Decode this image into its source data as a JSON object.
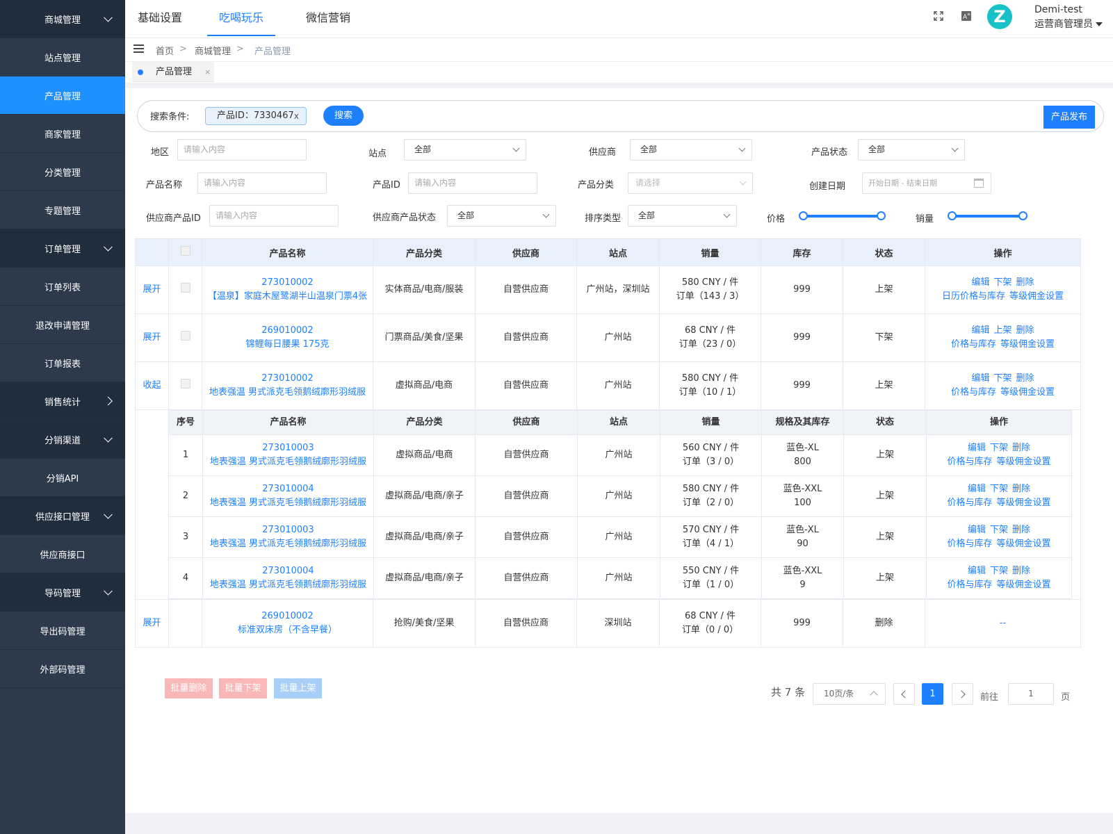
{
  "sidebar": {
    "items": [
      {
        "label": "商城管理",
        "type": "group",
        "chev": "down"
      },
      {
        "label": "站点管理",
        "type": "item"
      },
      {
        "label": "产品管理",
        "type": "active"
      },
      {
        "label": "商家管理",
        "type": "item"
      },
      {
        "label": "分类管理",
        "type": "item"
      },
      {
        "label": "专题管理",
        "type": "item"
      },
      {
        "label": "订单管理",
        "type": "group",
        "chev": "down"
      },
      {
        "label": "订单列表",
        "type": "item"
      },
      {
        "label": "退改申请管理",
        "type": "item"
      },
      {
        "label": "订单报表",
        "type": "item"
      },
      {
        "label": "销售统计",
        "type": "group",
        "chev": "right"
      },
      {
        "label": "分销渠道",
        "type": "group",
        "chev": "down"
      },
      {
        "label": "分销API",
        "type": "item"
      },
      {
        "label": "供应接口管理",
        "type": "group",
        "chev": "down"
      },
      {
        "label": "供应商接口",
        "type": "item"
      },
      {
        "label": "导码管理",
        "type": "group",
        "chev": "down"
      },
      {
        "label": "导出码管理",
        "type": "item"
      },
      {
        "label": "外部码管理",
        "type": "item"
      }
    ]
  },
  "header": {
    "tabs": [
      "基础设置",
      "吃喝玩乐",
      "微信营销"
    ],
    "active_tab": 1,
    "avatar_letter": "Z",
    "user_name": "Demi-test",
    "user_role": "运营商管理员"
  },
  "breadcrumb": [
    "首页",
    "商城管理",
    "产品管理"
  ],
  "page_tag": "产品管理",
  "search": {
    "label": "搜索条件:",
    "chip": "产品ID：7330467",
    "chip_close": "x",
    "search_btn": "搜索",
    "publish_btn": "产品发布"
  },
  "filters": {
    "region_label": "地区",
    "region_ph": "请输入内容",
    "site_label": "站点",
    "site_val": "全部",
    "supplier_label": "供应商",
    "supplier_val": "全部",
    "status_label": "产品状态",
    "status_val": "全部",
    "name_label": "产品名称",
    "name_ph": "请输入内容",
    "id_label": "产品ID",
    "id_ph": "请输入内容",
    "cat_label": "产品分类",
    "cat_ph": "请选择",
    "date_label": "创建日期",
    "date_ph": "开始日期  -  结束日期",
    "sup_pid_label": "供应商产品ID",
    "sup_pid_ph": "请输入内容",
    "sup_status_label": "供应商产品状态",
    "sup_status_val": "全部",
    "sort_label": "排序类型",
    "sort_val": "全部",
    "price_label": "价格",
    "sales_label": "销量"
  },
  "table": {
    "headers": [
      "产品名称",
      "产品分类",
      "供应商",
      "站点",
      "销量",
      "库存",
      "状态",
      "操作"
    ],
    "rows": [
      {
        "toggle": "展开",
        "id": "273010002",
        "name": "【温泉】家庭木屋鹭湖半山温泉门票4张",
        "cat": "实体商品/电商/服装",
        "sup": "自营供应商",
        "site": "广州站，深圳站",
        "price": "580 CNY / 件",
        "orders": "订单（143 / 3）",
        "stock": "999",
        "status": "上架",
        "ops1": [
          "编辑",
          "下架",
          "删除"
        ],
        "ops2": [
          "日历价格与库存",
          "等级佣金设置"
        ]
      },
      {
        "toggle": "展开",
        "id": "269010002",
        "name": "锦鲤每日腰果 175克",
        "cat": "门票商品/美食/坚果",
        "sup": "自营供应商",
        "site": "广州站",
        "price": "68 CNY / 件",
        "orders": "订单（23 / 0）",
        "stock": "999",
        "status": "下架",
        "ops1": [
          "编辑",
          "上架",
          "删除"
        ],
        "ops2": [
          "价格与库存",
          "等级佣金设置"
        ]
      },
      {
        "toggle": "收起",
        "id": "273010002",
        "name": "地表强温 男式派克毛领鹅绒廓形羽绒服",
        "cat": "虚拟商品/电商",
        "sup": "自营供应商",
        "site": "广州站",
        "price": "580 CNY / 件",
        "orders": "订单（10 / 1）",
        "stock": "999",
        "status": "上架",
        "ops1": [
          "编辑",
          "下架",
          "删除"
        ],
        "ops2": [
          "价格与库存",
          "等级佣金设置"
        ]
      }
    ],
    "last_row": {
      "toggle": "展开",
      "id": "269010002",
      "name": "标准双床房（不含早餐）",
      "cat": "抢购/美食/坚果",
      "sup": "自营供应商",
      "site": "深圳站",
      "price": "68 CNY / 件",
      "orders": "订单（0 / 0）",
      "stock": "999",
      "status": "删除",
      "ops": "--"
    }
  },
  "subtable": {
    "headers": [
      "序号",
      "产品名称",
      "产品分类",
      "供应商",
      "站点",
      "销量",
      "规格及其库存",
      "状态",
      "操作"
    ],
    "rows": [
      {
        "no": "1",
        "id": "273010003",
        "name": "地表强温 男式派克毛领鹅绒廓形羽绒服",
        "cat": "虚拟商品/电商",
        "sup": "自营供应商",
        "site": "广州站",
        "price": "560 CNY / 件",
        "orders": "订单（3 / 0）",
        "spec": "蓝色-XL",
        "spec_stock": "800",
        "status": "上架",
        "ops1": [
          "编辑",
          "下架",
          "删除"
        ],
        "ops2": [
          "价格与库存",
          "等级佣金设置"
        ]
      },
      {
        "no": "2",
        "id": "273010004",
        "name": "地表强温 男式派克毛领鹅绒廓形羽绒服",
        "cat": "虚拟商品/电商/亲子",
        "sup": "自营供应商",
        "site": "广州站",
        "price": "580 CNY / 件",
        "orders": "订单（2 / 0）",
        "spec": "蓝色-XXL",
        "spec_stock": "100",
        "status": "上架",
        "ops1": [
          "编辑",
          "下架",
          "删除"
        ],
        "ops2": [
          "价格与库存",
          "等级佣金设置"
        ]
      },
      {
        "no": "3",
        "id": "273010003",
        "name": "地表强温 男式派克毛领鹅绒廓形羽绒服",
        "cat": "虚拟商品/电商/亲子",
        "sup": "自营供应商",
        "site": "广州站",
        "price": "570 CNY / 件",
        "orders": "订单（4 / 1）",
        "spec": "蓝色-XL",
        "spec_stock": "90",
        "status": "上架",
        "ops1": [
          "编辑",
          "下架",
          "删除"
        ],
        "ops2": [
          "价格与库存",
          "等级佣金设置"
        ]
      },
      {
        "no": "4",
        "id": "273010004",
        "name": "地表强温 男式派克毛领鹅绒廓形羽绒服",
        "cat": "虚拟商品/电商/亲子",
        "sup": "自营供应商",
        "site": "广州站",
        "price": "550 CNY / 件",
        "orders": "订单（1 / 0）",
        "spec": "蓝色-XXL",
        "spec_stock": "9",
        "status": "上架",
        "ops1": [
          "编辑",
          "下架",
          "删除"
        ],
        "ops2": [
          "价格与库存",
          "等级佣金设置"
        ]
      }
    ]
  },
  "bulk": {
    "delete": "批量删除",
    "off": "批量下架",
    "on": "批量上架",
    "colors": {
      "delete": "#f9b7b7",
      "off": "#f9b7b7",
      "on": "#a8cff8"
    }
  },
  "pagination": {
    "total": "共 7 条",
    "page_size": "10页/条",
    "current": "1",
    "goto": "前往",
    "goto_val": "1",
    "page_unit": "页"
  },
  "colors": {
    "accent": "#1e80ff",
    "sidebar": "#2c3a4b",
    "avatar": "#17c1c8"
  }
}
